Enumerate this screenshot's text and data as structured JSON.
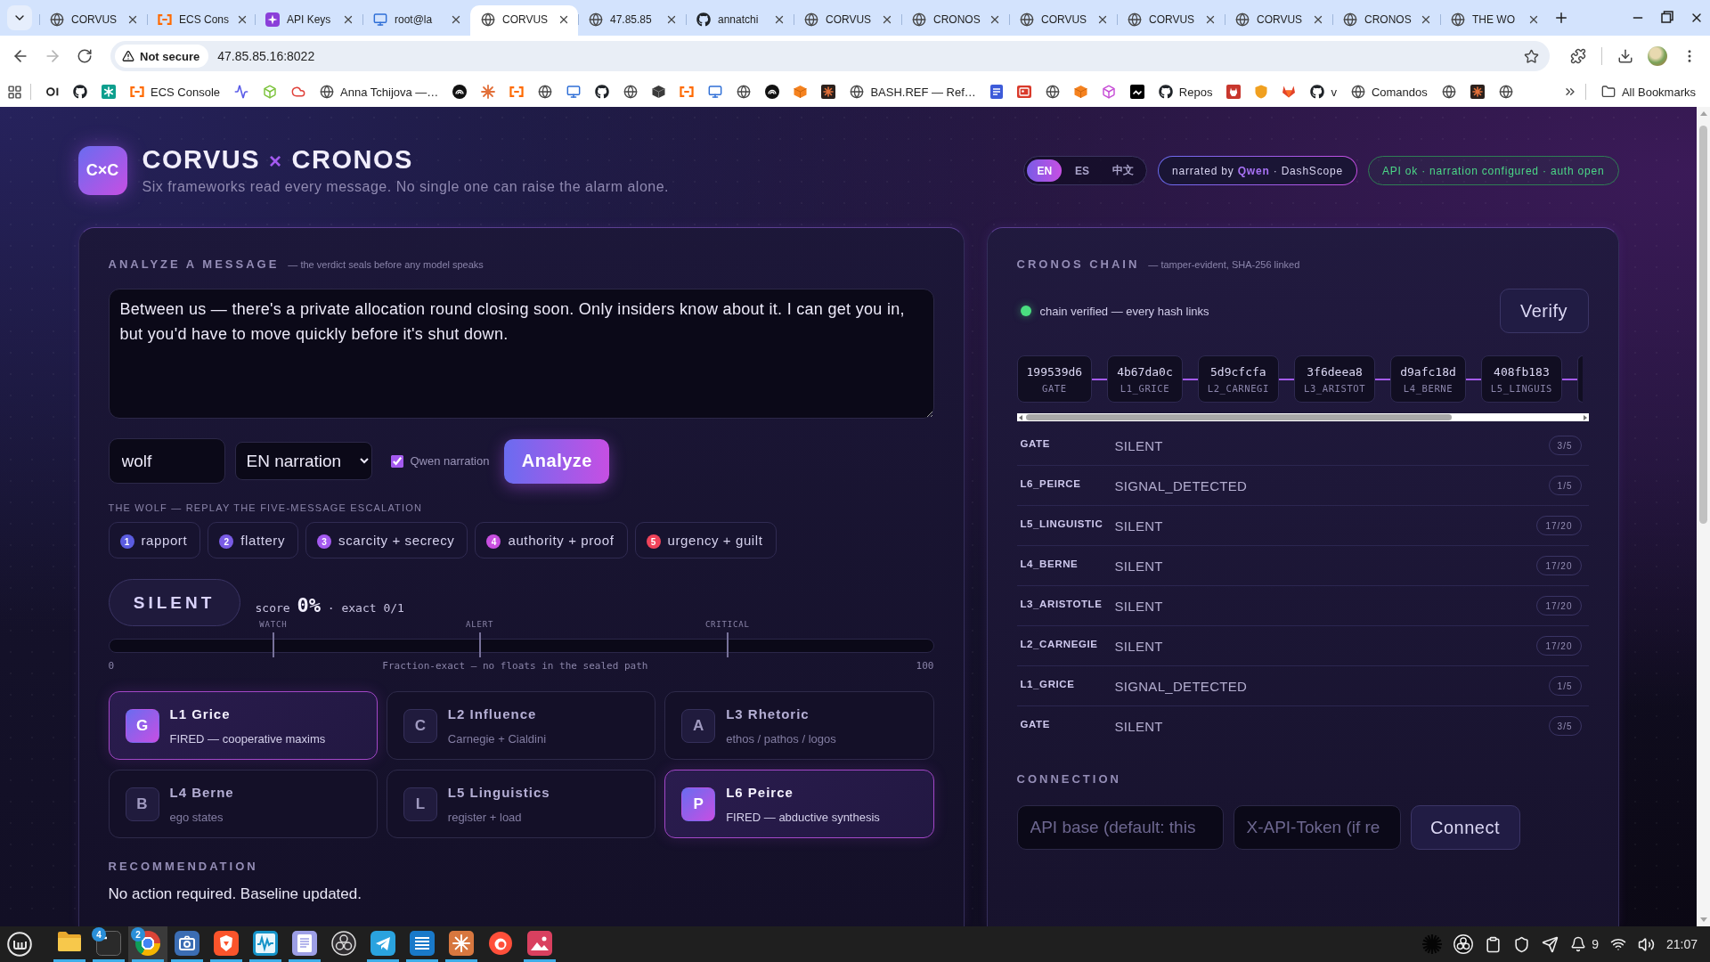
{
  "browser": {
    "tabs": [
      {
        "title": "CORVUS",
        "selected": false
      },
      {
        "title": "ECS Cons",
        "selected": false
      },
      {
        "title": "API Keys",
        "selected": false
      },
      {
        "title": "root@la",
        "selected": false
      },
      {
        "title": "CORVUS",
        "selected": true
      },
      {
        "title": "47.85.85",
        "selected": false
      },
      {
        "title": "annatchi",
        "selected": false
      },
      {
        "title": "CORVUS",
        "selected": false
      },
      {
        "title": "CRONOS",
        "selected": false
      },
      {
        "title": "CORVUS",
        "selected": false
      },
      {
        "title": "CORVUS",
        "selected": false
      },
      {
        "title": "CORVUS",
        "selected": false
      },
      {
        "title": "CRONOS",
        "selected": false
      },
      {
        "title": "THE WO",
        "selected": false
      }
    ],
    "address": {
      "security": "Not secure",
      "url": "47.85.85.16:8022"
    },
    "bookmarks": [
      {
        "kind": "icon"
      },
      {
        "kind": "icon"
      },
      {
        "kind": "icon"
      },
      {
        "kind": "link",
        "label": "ECS Console"
      },
      {
        "kind": "icon"
      },
      {
        "kind": "icon"
      },
      {
        "kind": "icon"
      },
      {
        "kind": "link",
        "label": "Anna Tchijova —…"
      },
      {
        "kind": "icon"
      },
      {
        "kind": "icon"
      },
      {
        "kind": "icon"
      },
      {
        "kind": "icon"
      },
      {
        "kind": "icon"
      },
      {
        "kind": "icon"
      },
      {
        "kind": "icon"
      },
      {
        "kind": "icon"
      },
      {
        "kind": "icon"
      },
      {
        "kind": "icon"
      },
      {
        "kind": "icon"
      },
      {
        "kind": "icon"
      },
      {
        "kind": "icon"
      },
      {
        "kind": "icon"
      },
      {
        "kind": "link",
        "label": "BASH.REF — Ref…"
      },
      {
        "kind": "icon"
      },
      {
        "kind": "icon"
      },
      {
        "kind": "icon"
      },
      {
        "kind": "icon"
      },
      {
        "kind": "icon"
      },
      {
        "kind": "icon"
      },
      {
        "kind": "link",
        "label": "Repos"
      },
      {
        "kind": "icon"
      },
      {
        "kind": "icon"
      },
      {
        "kind": "icon"
      },
      {
        "kind": "link",
        "label": "v"
      },
      {
        "kind": "link",
        "label": "Comandos"
      },
      {
        "kind": "icon"
      },
      {
        "kind": "icon"
      },
      {
        "kind": "icon"
      }
    ],
    "all_bookmarks": "All Bookmarks"
  },
  "header": {
    "logo": "C×C",
    "title": {
      "left": "CORVUS",
      "joiner": "×",
      "right": "CRONOS"
    },
    "subtitle": "Six frameworks read every message. No single one can raise the alarm alone.",
    "languages": [
      {
        "label": "EN",
        "selected": true
      },
      {
        "label": "ES",
        "selected": false
      },
      {
        "label": "中文",
        "selected": false
      }
    ],
    "narration_badge": "narrated by **Qwen** · DashScope",
    "status_badge": "API ok · narration configured · auth open"
  },
  "analyze": {
    "title": "ANALYZE A MESSAGE",
    "note": "— the verdict seals before any model speaks",
    "message": "Between us — there's a private allocation round closing soon. Only insiders know about it. I can get you in, but you'd have to move quickly before it's shut down.",
    "persona": "wolf",
    "narration": "EN narration",
    "qwen_narration": {
      "label": "Qwen narration",
      "checked": true
    },
    "analyze_button": "Analyze",
    "replay_title": "THE WOLF — REPLAY THE FIVE-MESSAGE ESCALATION",
    "steps": [
      {
        "number": "1",
        "label": "rapport",
        "color": "#5b5ce0"
      },
      {
        "number": "2",
        "label": "flattery",
        "color": "#7a5ce6"
      },
      {
        "number": "3",
        "label": "scarcity + secrecy",
        "color": "#a45af0"
      },
      {
        "number": "4",
        "label": "authority + proof",
        "color": "#c84fe0"
      },
      {
        "number": "5",
        "label": "urgency + guilt",
        "color": "#f0435a"
      }
    ],
    "verdict": "SILENT",
    "score": {
      "label": "score",
      "value": "0%",
      "exact": "· exact 0/1"
    },
    "meter": {
      "thresholds": [
        {
          "label": "WATCH",
          "level": 0.2
        },
        {
          "label": "ALERT",
          "level": 0.45
        },
        {
          "label": "CRITICAL",
          "level": 0.75
        }
      ],
      "min": "0",
      "caption": "Fraction-exact — no floats in the sealed path",
      "max": "100"
    },
    "frameworks": [
      {
        "letter": "G",
        "name": "L1 Grice",
        "detail": "FIRED — cooperative maxims",
        "fired": true
      },
      {
        "letter": "C",
        "name": "L2 Influence",
        "detail": "Carnegie + Cialdini",
        "fired": false
      },
      {
        "letter": "A",
        "name": "L3 Rhetoric",
        "detail": "ethos / pathos / logos",
        "fired": false
      },
      {
        "letter": "B",
        "name": "L4 Berne",
        "detail": "ego states",
        "fired": false
      },
      {
        "letter": "L",
        "name": "L5 Linguistics",
        "detail": "register + load",
        "fired": false
      },
      {
        "letter": "P",
        "name": "L6 Peirce",
        "detail": "FIRED — abductive synthesis",
        "fired": true
      }
    ],
    "recommendation": {
      "title": "RECOMMENDATION",
      "text": "No action required. Baseline updated."
    }
  },
  "chain": {
    "title": "CRONOS CHAIN",
    "note": "— tamper-evident, SHA-256 linked",
    "verified": true,
    "status": "chain verified — every hash links",
    "verify_button": "Verify",
    "blocks": [
      {
        "hash": "199539d6",
        "layer": "GATE"
      },
      {
        "hash": "4b67da0c",
        "layer": "L1_GRICE"
      },
      {
        "hash": "5d9cfcfa",
        "layer": "L2_CARNEGI"
      },
      {
        "hash": "3f6deea8",
        "layer": "L3_ARISTOT"
      },
      {
        "hash": "d9afc18d",
        "layer": "L4_BERNE"
      },
      {
        "hash": "408fb183",
        "layer": "L5_LINGUIS"
      }
    ],
    "rows": [
      {
        "layer": "GATE",
        "verdict": "SILENT",
        "count": "3/5"
      },
      {
        "layer": "L6_PEIRCE",
        "verdict": "SIGNAL_DETECTED",
        "count": "1/5"
      },
      {
        "layer": "L5_LINGUISTIC",
        "verdict": "SILENT",
        "count": "17/20"
      },
      {
        "layer": "L4_BERNE",
        "verdict": "SILENT",
        "count": "17/20"
      },
      {
        "layer": "L3_ARISTOTLE",
        "verdict": "SILENT",
        "count": "17/20"
      },
      {
        "layer": "L2_CARNEGIE",
        "verdict": "SILENT",
        "count": "17/20"
      },
      {
        "layer": "L1_GRICE",
        "verdict": "SIGNAL_DETECTED",
        "count": "1/5"
      },
      {
        "layer": "GATE",
        "verdict": "SILENT",
        "count": "3/5"
      }
    ],
    "connection": {
      "title": "CONNECTION",
      "api_placeholder": "API base (default: this",
      "token_placeholder": "X-API-Token (if re",
      "button": "Connect"
    }
  },
  "taskbar": {
    "apps": [
      {
        "running": true,
        "focused": false
      },
      {
        "running": true,
        "focused": false,
        "badge": "4"
      },
      {
        "running": true,
        "focused": true,
        "badge": "2"
      },
      {
        "running": true,
        "focused": false
      },
      {
        "running": true,
        "focused": false
      },
      {
        "running": true,
        "focused": false
      },
      {
        "running": true,
        "focused": false
      },
      {
        "running": false,
        "focused": false
      },
      {
        "running": true,
        "focused": false
      },
      {
        "running": true,
        "focused": false
      },
      {
        "running": true,
        "focused": false
      },
      {
        "running": false,
        "focused": false
      },
      {
        "running": true,
        "focused": false
      }
    ],
    "notifications": "9",
    "clock": "21:07"
  }
}
